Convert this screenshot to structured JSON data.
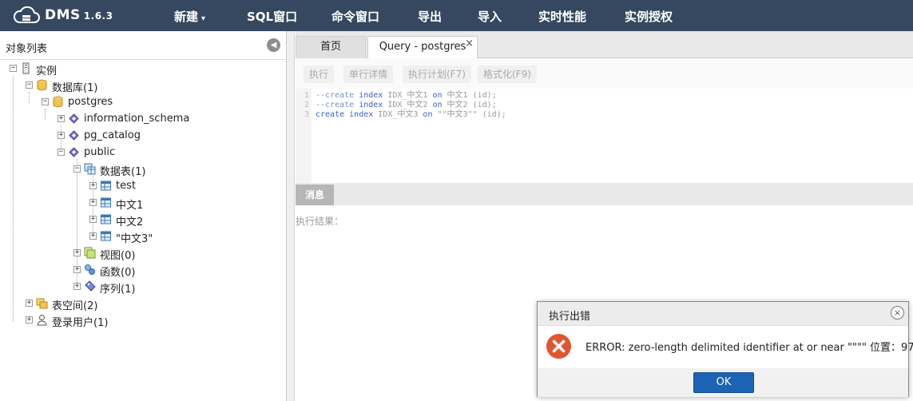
{
  "header": {
    "app_name": "DMS",
    "version": "1.6.3",
    "nav": [
      {
        "label": "新建",
        "has_caret": true
      },
      {
        "label": "SQL窗口"
      },
      {
        "label": "命令窗口"
      },
      {
        "label": "导出"
      },
      {
        "label": "导入"
      },
      {
        "label": "实时性能"
      },
      {
        "label": "实例授权"
      }
    ]
  },
  "sidebar": {
    "title": "对象列表",
    "tree": [
      {
        "label": "实例",
        "icon": "server-icon",
        "toggle": "−"
      },
      {
        "label": "数据库(1)",
        "icon": "database-icon",
        "toggle": "−"
      },
      {
        "label": "postgres",
        "icon": "database-icon",
        "toggle": "−"
      },
      {
        "label": "information_schema",
        "icon": "schema-icon",
        "toggle": "+"
      },
      {
        "label": "pg_catalog",
        "icon": "schema-icon",
        "toggle": "+"
      },
      {
        "label": "public",
        "icon": "schema-icon",
        "toggle": "−"
      },
      {
        "label": "数据表(1)",
        "icon": "tables-folder-icon",
        "toggle": "−"
      },
      {
        "label": "test",
        "icon": "table-icon",
        "toggle": "+"
      },
      {
        "label": "中文1",
        "icon": "table-icon",
        "toggle": "+"
      },
      {
        "label": "中文2",
        "icon": "table-icon",
        "toggle": "+"
      },
      {
        "label": "\"中文3\"",
        "icon": "table-icon",
        "toggle": "+"
      },
      {
        "label": "视图(0)",
        "icon": "view-icon",
        "toggle": "+"
      },
      {
        "label": "函数(0)",
        "icon": "function-icon",
        "toggle": "+"
      },
      {
        "label": "序列(1)",
        "icon": "sequence-icon",
        "toggle": "+"
      },
      {
        "label": "表空间(2)",
        "icon": "tablespace-icon",
        "toggle": "+"
      },
      {
        "label": "登录用户(1)",
        "icon": "user-icon",
        "toggle": "+"
      }
    ]
  },
  "tabs": [
    {
      "label": "首页"
    },
    {
      "label": "Query - postgres",
      "close": "×"
    }
  ],
  "toolbar": {
    "execute": "执行",
    "row_detail": "单行详情",
    "plan": "执行计划(F7)",
    "format": "格式化(F9)"
  },
  "editor": {
    "line_numbers": [
      "1",
      "2",
      "3"
    ],
    "lines": [
      {
        "parts": [
          {
            "t": "--create",
            "c": "cm"
          },
          {
            "t": " ",
            "c": ""
          },
          {
            "t": "index",
            "c": "kw"
          },
          {
            "t": " IDX_中文1 ",
            "c": ""
          },
          {
            "t": "on",
            "c": "kw"
          },
          {
            "t": " 中文1 (id);",
            "c": ""
          }
        ]
      },
      {
        "parts": [
          {
            "t": "--create",
            "c": "cm"
          },
          {
            "t": " ",
            "c": ""
          },
          {
            "t": "index",
            "c": "kw"
          },
          {
            "t": " IDX_中文2 ",
            "c": ""
          },
          {
            "t": "on",
            "c": "kw"
          },
          {
            "t": " 中文2 (id);",
            "c": ""
          }
        ]
      },
      {
        "parts": [
          {
            "t": "create",
            "c": "kw"
          },
          {
            "t": " ",
            "c": ""
          },
          {
            "t": "index",
            "c": "kw"
          },
          {
            "t": " IDX_中文3 ",
            "c": ""
          },
          {
            "t": "on",
            "c": "kw"
          },
          {
            "t": " \"\"中文3\"\" (id);",
            "c": ""
          }
        ]
      }
    ]
  },
  "messages": {
    "tab_label": "消息",
    "result_label": "执行结果："
  },
  "dialog": {
    "title": "执行出错",
    "close": "×",
    "error_icon": "error-x-icon",
    "message": "ERROR: zero-length delimited identifier at or near \"\"\"\" 位置：97",
    "ok": "OK"
  },
  "colors": {
    "topbar": "#35485f",
    "ok_button": "#1d63b3",
    "error_icon": "#e0562f"
  }
}
